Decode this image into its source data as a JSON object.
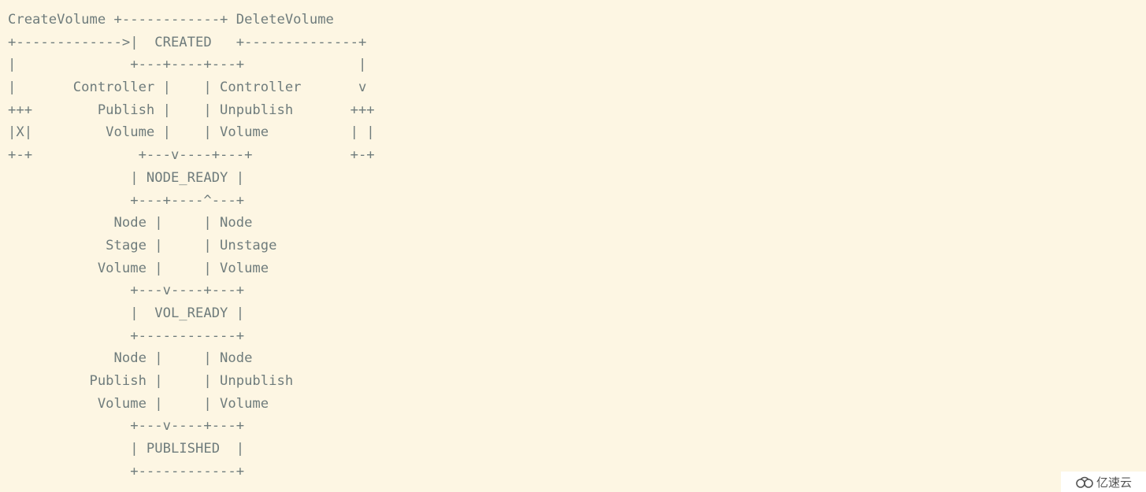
{
  "diagram": {
    "lines": [
      "CreateVolume +------------+ DeleteVolume",
      "+------------->|  CREATED   +--------------+",
      "|              +---+----+---+              |",
      "|       Controller |    | Controller       v",
      "+++        Publish |    | Unpublish       +++",
      "|X|         Volume |    | Volume          | |",
      "+-+             +---v----+---+            +-+",
      "               | NODE_READY |",
      "               +---+----^---+",
      "             Node |     | Node",
      "            Stage |     | Unstage",
      "           Volume |     | Volume",
      "               +---v----+---+",
      "               |  VOL_READY |",
      "               +------------+",
      "             Node |     | Node",
      "          Publish |     | Unpublish",
      "           Volume |     | Volume",
      "               +---v----+---+",
      "               | PUBLISHED  |",
      "               +------------+"
    ]
  },
  "watermark": {
    "text": "亿速云",
    "icon": "cloud-logo-icon"
  },
  "colors": {
    "background": "#fdf6e3",
    "text": "#6f7c7c"
  }
}
